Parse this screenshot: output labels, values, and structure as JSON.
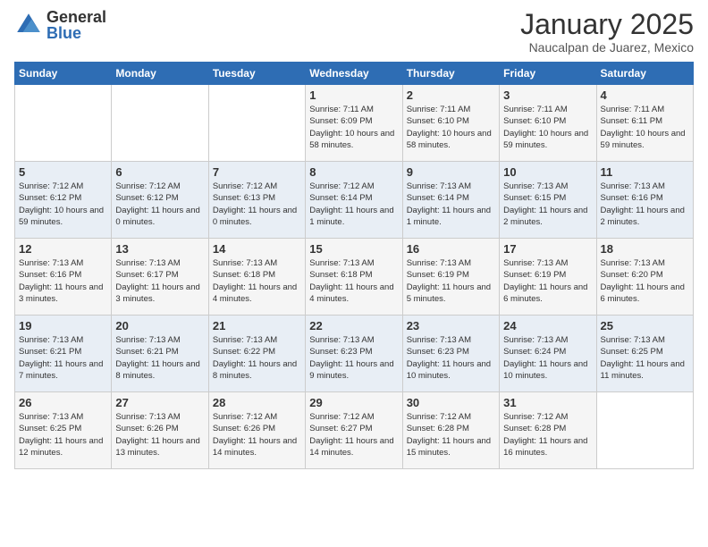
{
  "logo": {
    "general": "General",
    "blue": "Blue"
  },
  "title": "January 2025",
  "subtitle": "Naucalpan de Juarez, Mexico",
  "days_of_week": [
    "Sunday",
    "Monday",
    "Tuesday",
    "Wednesday",
    "Thursday",
    "Friday",
    "Saturday"
  ],
  "weeks": [
    [
      {
        "day": "",
        "info": ""
      },
      {
        "day": "",
        "info": ""
      },
      {
        "day": "",
        "info": ""
      },
      {
        "day": "1",
        "info": "Sunrise: 7:11 AM\nSunset: 6:09 PM\nDaylight: 10 hours and 58 minutes."
      },
      {
        "day": "2",
        "info": "Sunrise: 7:11 AM\nSunset: 6:10 PM\nDaylight: 10 hours and 58 minutes."
      },
      {
        "day": "3",
        "info": "Sunrise: 7:11 AM\nSunset: 6:10 PM\nDaylight: 10 hours and 59 minutes."
      },
      {
        "day": "4",
        "info": "Sunrise: 7:11 AM\nSunset: 6:11 PM\nDaylight: 10 hours and 59 minutes."
      }
    ],
    [
      {
        "day": "5",
        "info": "Sunrise: 7:12 AM\nSunset: 6:12 PM\nDaylight: 10 hours and 59 minutes."
      },
      {
        "day": "6",
        "info": "Sunrise: 7:12 AM\nSunset: 6:12 PM\nDaylight: 11 hours and 0 minutes."
      },
      {
        "day": "7",
        "info": "Sunrise: 7:12 AM\nSunset: 6:13 PM\nDaylight: 11 hours and 0 minutes."
      },
      {
        "day": "8",
        "info": "Sunrise: 7:12 AM\nSunset: 6:14 PM\nDaylight: 11 hours and 1 minute."
      },
      {
        "day": "9",
        "info": "Sunrise: 7:13 AM\nSunset: 6:14 PM\nDaylight: 11 hours and 1 minute."
      },
      {
        "day": "10",
        "info": "Sunrise: 7:13 AM\nSunset: 6:15 PM\nDaylight: 11 hours and 2 minutes."
      },
      {
        "day": "11",
        "info": "Sunrise: 7:13 AM\nSunset: 6:16 PM\nDaylight: 11 hours and 2 minutes."
      }
    ],
    [
      {
        "day": "12",
        "info": "Sunrise: 7:13 AM\nSunset: 6:16 PM\nDaylight: 11 hours and 3 minutes."
      },
      {
        "day": "13",
        "info": "Sunrise: 7:13 AM\nSunset: 6:17 PM\nDaylight: 11 hours and 3 minutes."
      },
      {
        "day": "14",
        "info": "Sunrise: 7:13 AM\nSunset: 6:18 PM\nDaylight: 11 hours and 4 minutes."
      },
      {
        "day": "15",
        "info": "Sunrise: 7:13 AM\nSunset: 6:18 PM\nDaylight: 11 hours and 4 minutes."
      },
      {
        "day": "16",
        "info": "Sunrise: 7:13 AM\nSunset: 6:19 PM\nDaylight: 11 hours and 5 minutes."
      },
      {
        "day": "17",
        "info": "Sunrise: 7:13 AM\nSunset: 6:19 PM\nDaylight: 11 hours and 6 minutes."
      },
      {
        "day": "18",
        "info": "Sunrise: 7:13 AM\nSunset: 6:20 PM\nDaylight: 11 hours and 6 minutes."
      }
    ],
    [
      {
        "day": "19",
        "info": "Sunrise: 7:13 AM\nSunset: 6:21 PM\nDaylight: 11 hours and 7 minutes."
      },
      {
        "day": "20",
        "info": "Sunrise: 7:13 AM\nSunset: 6:21 PM\nDaylight: 11 hours and 8 minutes."
      },
      {
        "day": "21",
        "info": "Sunrise: 7:13 AM\nSunset: 6:22 PM\nDaylight: 11 hours and 8 minutes."
      },
      {
        "day": "22",
        "info": "Sunrise: 7:13 AM\nSunset: 6:23 PM\nDaylight: 11 hours and 9 minutes."
      },
      {
        "day": "23",
        "info": "Sunrise: 7:13 AM\nSunset: 6:23 PM\nDaylight: 11 hours and 10 minutes."
      },
      {
        "day": "24",
        "info": "Sunrise: 7:13 AM\nSunset: 6:24 PM\nDaylight: 11 hours and 10 minutes."
      },
      {
        "day": "25",
        "info": "Sunrise: 7:13 AM\nSunset: 6:25 PM\nDaylight: 11 hours and 11 minutes."
      }
    ],
    [
      {
        "day": "26",
        "info": "Sunrise: 7:13 AM\nSunset: 6:25 PM\nDaylight: 11 hours and 12 minutes."
      },
      {
        "day": "27",
        "info": "Sunrise: 7:13 AM\nSunset: 6:26 PM\nDaylight: 11 hours and 13 minutes."
      },
      {
        "day": "28",
        "info": "Sunrise: 7:12 AM\nSunset: 6:26 PM\nDaylight: 11 hours and 14 minutes."
      },
      {
        "day": "29",
        "info": "Sunrise: 7:12 AM\nSunset: 6:27 PM\nDaylight: 11 hours and 14 minutes."
      },
      {
        "day": "30",
        "info": "Sunrise: 7:12 AM\nSunset: 6:28 PM\nDaylight: 11 hours and 15 minutes."
      },
      {
        "day": "31",
        "info": "Sunrise: 7:12 AM\nSunset: 6:28 PM\nDaylight: 11 hours and 16 minutes."
      },
      {
        "day": "",
        "info": ""
      }
    ]
  ]
}
